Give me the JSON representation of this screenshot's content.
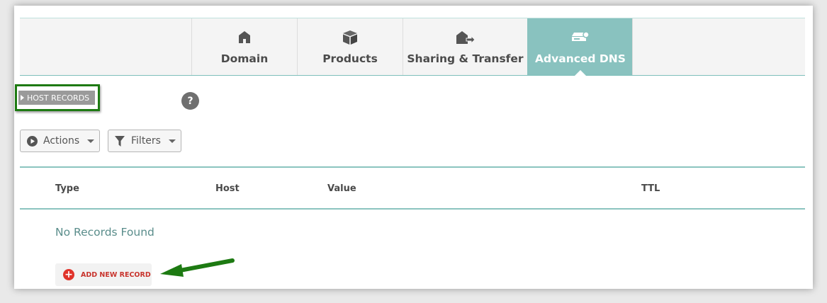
{
  "tabs": [
    {
      "label": "Domain",
      "icon": "home-icon"
    },
    {
      "label": "Products",
      "icon": "box-icon"
    },
    {
      "label": "Sharing & Transfer",
      "icon": "share-transfer-icon"
    },
    {
      "label": "Advanced DNS",
      "icon": "dns-server-icon",
      "active": true
    }
  ],
  "section": {
    "title": "HOST RECORDS",
    "help_label": "?"
  },
  "toolbar": {
    "actions_label": "Actions",
    "filters_label": "Filters"
  },
  "table": {
    "columns": [
      "Type",
      "Host",
      "Value",
      "TTL"
    ],
    "empty_message": "No Records Found"
  },
  "add_record_label": "ADD NEW RECORD",
  "colors": {
    "accent": "#89c2bf",
    "highlight_green": "#1d7a12",
    "add_red": "#e0332a"
  }
}
